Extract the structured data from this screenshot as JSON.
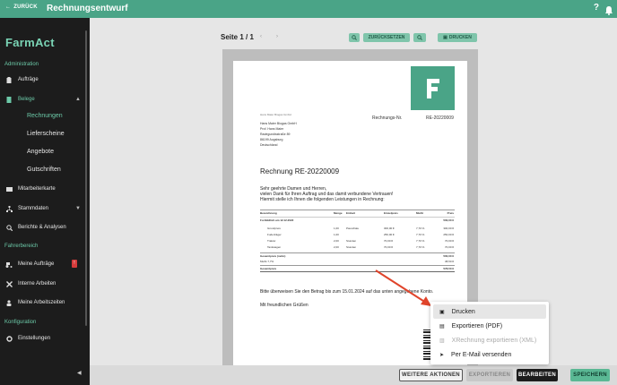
{
  "topbar": {
    "back_label": "ZURÜCK",
    "title": "Rechnungsentwurf",
    "help": "?"
  },
  "sidebar": {
    "logo": "FarmAct",
    "section_admin": "Administration",
    "auftraege": "Aufträge",
    "belege": "Belege",
    "sub": [
      "Rechnungen",
      "Lieferscheine",
      "Angebote",
      "Gutschriften"
    ],
    "mitarbeiterkarte": "Mitarbeiterkarte",
    "stammdaten": "Stammdaten",
    "berichte": "Berichte & Analysen",
    "section_fahrer": "Fahrerbereich",
    "meine_auftraege": "Meine Aufträge",
    "badge": "!",
    "interne": "Interne Arbeiten",
    "arbeitszeiten": "Meine Arbeitszeiten",
    "section_konfig": "Konfiguration",
    "einstellungen": "Einstellungen"
  },
  "toolbar": {
    "pages": "Seite 1 / 1",
    "reset": "ZURÜCKSETZEN",
    "print": "DRUCKEN"
  },
  "doc": {
    "sender": "Hans Maier Biogas GmbH",
    "addr": [
      "Hans Maier Biogas GmbH",
      "Prof. Hans Maier",
      "Radegundisstraße 89",
      "86199 Augsburg",
      "Deutschland"
    ],
    "invoice_no_label": "Rechnungs-Nr.",
    "invoice_no": "RE-20220009",
    "heading": "Rechnung RE-20220009",
    "greeting": "Sehr geehrte Damen und Herren,",
    "thanks1": "vielen Dank für Ihren Auftrag und das damit verbundene Vertrauen!",
    "thanks2": "Hiermit stelle ich Ihnen die folgenden Leistungen in Rechnung:",
    "footer1": "Bitte überweisen Sie den Betrag bis zum 15.01.2024 auf das unten angegebene Konto.",
    "footer2": "Mit freundlichen Grüßen",
    "rows": [
      [
        "Bezeichnung",
        "Menge",
        "Einheit",
        "Einzelpreis",
        "MwSt",
        "Preis"
      ],
      [
        "Fortbildlich am 12.12.2022",
        "",
        "",
        "",
        "",
        "500,00 €"
      ],
      [
        "Grundpreis",
        "1,00",
        "Pauschale",
        "300,00 €",
        "7,70 %",
        "300,00 €"
      ],
      [
        "Fuderträger",
        "1,00",
        "",
        "250,00 €",
        "7,70 %",
        "250,00 €"
      ],
      [
        "Traktor",
        "2,00",
        "Stunden",
        "70,00 €",
        "7,70 %",
        "70,00 €"
      ],
      [
        "Tankwagen",
        "2,00",
        "Stunden",
        "70,00 €",
        "7,70 %",
        "70,00 €"
      ],
      [
        "Gesamtpreis (netto)",
        "",
        "",
        "",
        "",
        "500,00 €"
      ],
      [
        "MwSt 7,7%",
        "",
        "",
        "",
        "",
        "38,50 €"
      ],
      [
        "Gesamtpreis",
        "",
        "",
        "",
        "",
        "578,50 €"
      ]
    ]
  },
  "bottombar": {
    "more": "WEITERE AKTIONEN",
    "export": "EXPORTIEREN",
    "edit": "BEARBEITEN",
    "save": "SPEICHERN"
  },
  "menu": [
    "Drucken",
    "Exportieren (PDF)",
    "XRechnung exportieren (XML)",
    "Per E-Mail versenden"
  ],
  "colors": {
    "brand": "#4aa487",
    "sidebar": "#1c1c1c",
    "accent": "#6cc9a8",
    "arrow": "#e0442b"
  }
}
